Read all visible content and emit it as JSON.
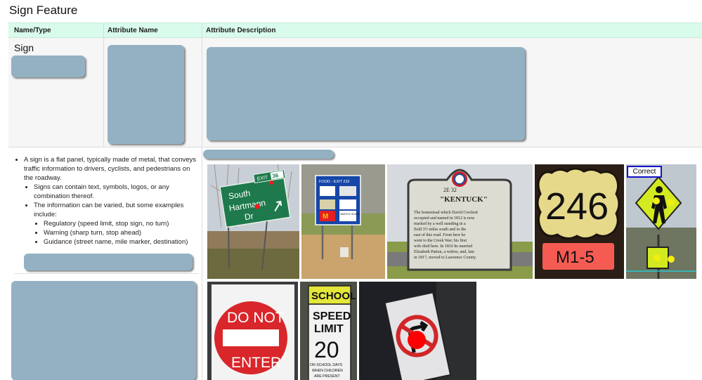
{
  "page": {
    "title": "Sign Feature"
  },
  "table": {
    "headers": [
      "Name/Type",
      "Attribute Name",
      "Attribute Description"
    ],
    "row1": {
      "name_type": "Sign"
    }
  },
  "description": {
    "intro": "A sign is a flat panel, typically made of metal, that conveys traffic information to drivers, cyclists, and pedestrians on the roadway.",
    "point_content": "Signs can contain text, symbols, logos, or any combination thereof.",
    "point_varied": "The information can be varied, but some examples include:",
    "examples": [
      "Regulatory (speed limit, stop sign, no turn)",
      "Warning (sharp turn, stop ahead)",
      "Guidance (street name, mile marker, destination)"
    ]
  },
  "images": {
    "exit_sign": {
      "street": [
        "South",
        "Hartmann",
        "Dr"
      ],
      "exit_label": "EXIT",
      "exit_number": "36"
    },
    "food_sign": {
      "header": "FOOD - EXIT 232",
      "brand": "WAFFLE HOUSE"
    },
    "historical_marker": {
      "code": "2E  32",
      "title": "\"KENTUCK\"",
      "lines": [
        "The homestead which David Crockett",
        "occupied and named in 1812 is now",
        "marked by a well standing in a",
        "field 3½ miles south and to the",
        "east of this road. From here he",
        "went to the Creek War; his first",
        "wife died here. In 1816 he married",
        "Elizabeth Patton, a widow, and, late",
        "in 1817, moved to Lawrence County."
      ]
    },
    "route_shield": {
      "number": "246",
      "code_label": "M1-5"
    },
    "ped_sign": {
      "badge": "Correct"
    },
    "do_not_enter": {
      "line1": "DO NOT",
      "line2": "ENTER"
    },
    "school_speed": {
      "school": "SCHOOL",
      "speed": "SPEED",
      "limit": "LIMIT",
      "value": "20",
      "note1": "ON SCHOOL DAYS",
      "note2": "WHEN CHILDREN",
      "note3": "ARE PRESENT"
    }
  },
  "colors": {
    "header_bg": "#d9fbeb",
    "redaction": "#93b1c2",
    "correct_border": "#1313c8",
    "annotation_red": "#ff1a1a",
    "annotation_yellow": "#f2ee10"
  }
}
